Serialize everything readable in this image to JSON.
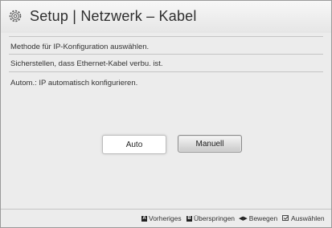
{
  "header": {
    "title": "Setup | Netzwerk – Kabel",
    "icon": "gear-icon"
  },
  "body": {
    "line1": "Methode für IP-Konfiguration auswählen.",
    "line2": "Sicherstellen, dass Ethernet-Kabel verbu. ist.",
    "line3": "Autom.: IP automatisch konfigurieren."
  },
  "buttons": {
    "auto": "Auto",
    "manual": "Manuell"
  },
  "footer": {
    "prev_key": "A",
    "prev_label": "Vorheriges",
    "skip_key": "B",
    "skip_label": "Überspringen",
    "move_label": "Bewegen",
    "select_label": "Auswählen"
  }
}
